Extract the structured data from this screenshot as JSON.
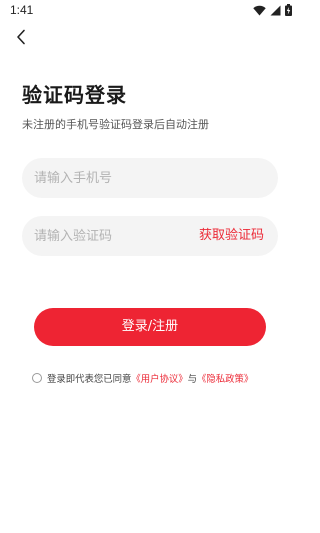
{
  "status_bar": {
    "time": "1:41",
    "icons": [
      "wifi-icon",
      "cellular-signal-icon",
      "battery-icon"
    ]
  },
  "header": {
    "back_icon": "chevron-left-icon"
  },
  "main": {
    "title": "验证码登录",
    "subtitle": "未注册的手机号验证码登录后自动注册",
    "phone_input": {
      "placeholder": "请输入手机号",
      "value": ""
    },
    "code_input": {
      "placeholder": "请输入验证码",
      "value": ""
    },
    "get_code_label": "获取验证码",
    "login_button_label": "登录/注册"
  },
  "agreement": {
    "checked": false,
    "prefix_text": "登录即代表您已同意",
    "user_agreement_link": "《用户协议》",
    "conjunction": "与",
    "privacy_policy_link": "《隐私政策》"
  },
  "colors": {
    "accent": "#ee2433",
    "link": "#ec2a37",
    "input_background": "#f4f4f4",
    "placeholder": "#b3b3b3"
  }
}
